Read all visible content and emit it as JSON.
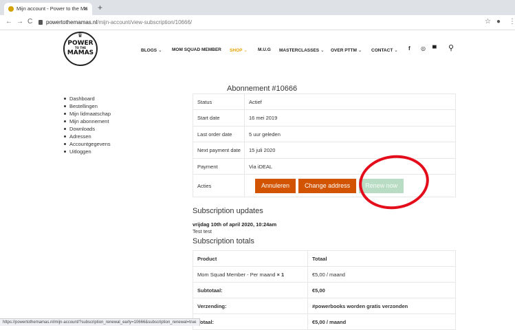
{
  "browser": {
    "tab_title": "Mijn account - Power to the Ma",
    "tab_close": "✕",
    "new_tab": "+",
    "url_host": "powertothemamas.nl",
    "url_path": "/mijn-account/view-subscription/10666/",
    "back": "←",
    "forward": "→",
    "reload": "C",
    "star": "☆",
    "profile": "●",
    "menu": "⋮"
  },
  "logo": {
    "line1": "POWER",
    "line2": "TO THE",
    "line3": "MAMAS"
  },
  "nav": [
    {
      "label": "BLOGS",
      "chevron": "⌄"
    },
    {
      "label": "MOM SQUAD MEMBER",
      "chevron": ""
    },
    {
      "label": "SHOP",
      "chevron": "⌄"
    },
    {
      "label": "M.U.G",
      "chevron": ""
    },
    {
      "label": "MASTERCLASSES",
      "chevron": "⌄"
    },
    {
      "label": "OVER PTTM",
      "chevron": "⌄"
    },
    {
      "label": "CONTACT",
      "chevron": "⌄"
    }
  ],
  "header_icons": {
    "facebook": "f",
    "instagram": "◎",
    "cart": "▀",
    "search": "⚲"
  },
  "page_title": "Abonnement #10666",
  "account_nav": [
    "Dashboard",
    "Bestellingen",
    "Mijn lidmaatschap",
    "Mijn abonnement",
    "Downloads",
    "Adressen",
    "Accountgegevens",
    "Uitloggen"
  ],
  "subscription": [
    {
      "key": "Status",
      "value": "Actief"
    },
    {
      "key": "Start date",
      "value": "16 mei 2019"
    },
    {
      "key": "Last order date",
      "value": "5 uur geleden"
    },
    {
      "key": "Next payment date",
      "value": "15 juli 2020"
    },
    {
      "key": "Payment",
      "value": "Via iDEAL"
    }
  ],
  "actions": {
    "label": "Acties",
    "cancel": "Annuleren",
    "change_address": "Change address",
    "renew": "Renew now"
  },
  "updates": {
    "title": "Subscription updates",
    "date": "vrijdag 10th of april 2020, 10:24am",
    "text": "Test test"
  },
  "totals": {
    "title": "Subscription totals",
    "header": [
      "Product",
      "Totaal"
    ],
    "product_name": "Mom Squad Member - Per maand",
    "product_qty": "× 1",
    "product_total": "€5,00 / maand",
    "subtotal_label": "Subtotaal:",
    "subtotal": "€5,00",
    "shipping_label": "Verzending:",
    "shipping": "#powerbooks worden gratis verzonden",
    "total_label": "Totaal:",
    "total": "€5,00 / maand"
  },
  "status_url": "https://powertothemamas.nl/mijn-account/?subscription_renewal_early=10666&subscription_renewal=true",
  "colors": {
    "accent_orange": "#d35400",
    "shop_active": "#e8a100",
    "renew_disabled": "#b9dcc5",
    "annotation_red": "#e40d1b"
  }
}
